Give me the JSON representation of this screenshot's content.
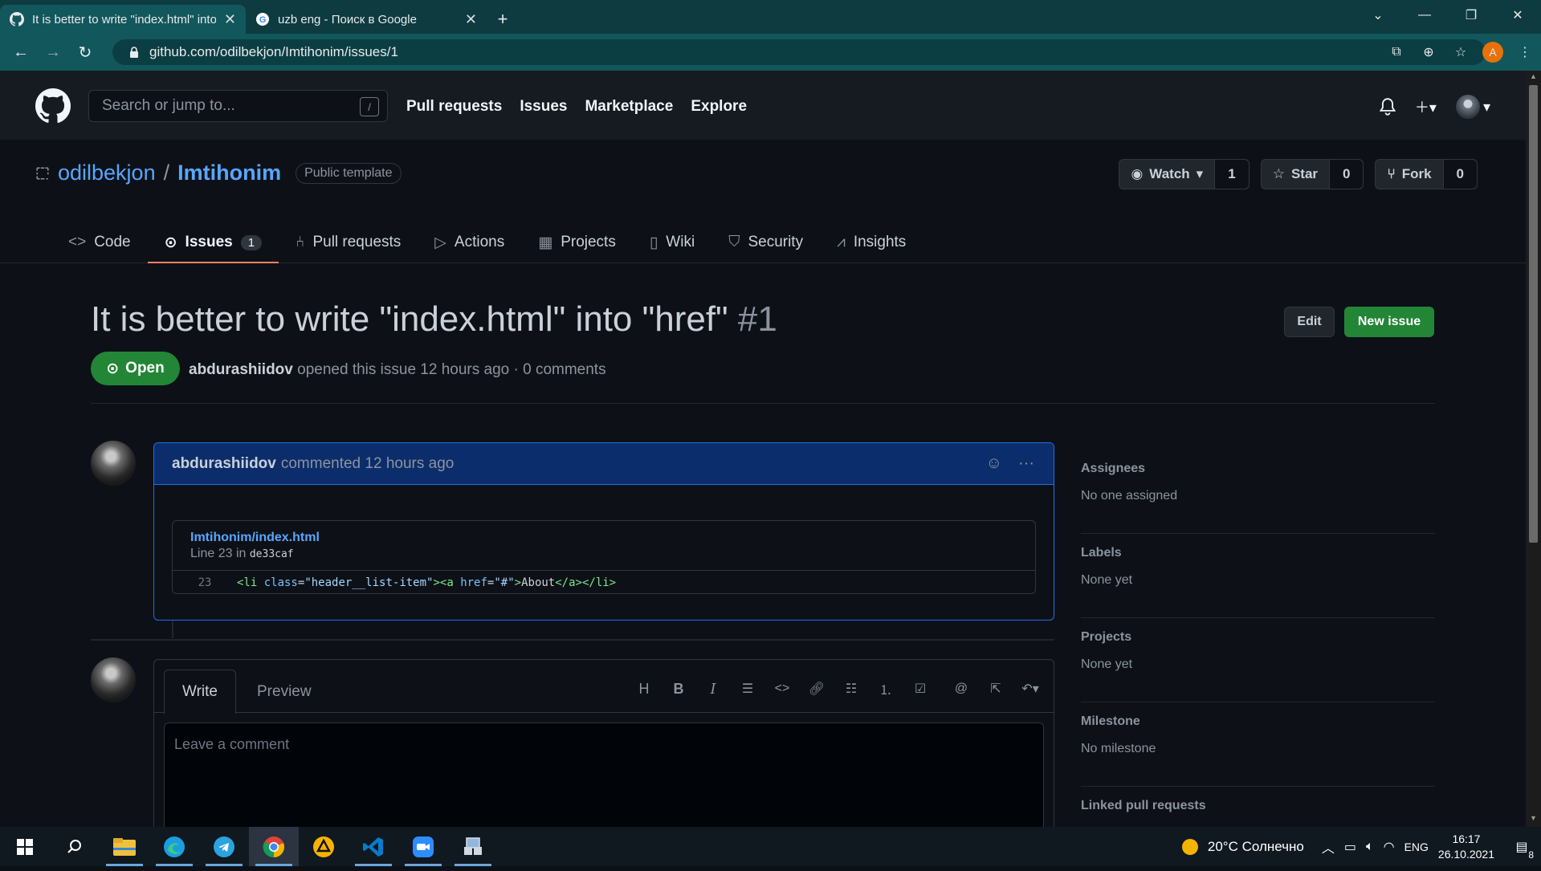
{
  "browser": {
    "tabs": [
      {
        "title": "It is better to write \"index.html\" into \"href\"",
        "active": true
      },
      {
        "title": "uzb eng - Поиск в Google",
        "active": false
      }
    ],
    "url": "github.com/odilbekjon/Imtihonim/issues/1",
    "profile_initial": "A"
  },
  "gh_header": {
    "search_placeholder": "Search or jump to...",
    "slash_key": "/",
    "nav": [
      "Pull requests",
      "Issues",
      "Marketplace",
      "Explore"
    ]
  },
  "repo": {
    "owner": "odilbekjon",
    "separator": "/",
    "name": "Imtihonim",
    "badge": "Public template",
    "watch": {
      "label": "Watch",
      "count": "1"
    },
    "star": {
      "label": "Star",
      "count": "0"
    },
    "fork": {
      "label": "Fork",
      "count": "0"
    },
    "tabs": [
      {
        "label": "Code",
        "icon": "code-icon"
      },
      {
        "label": "Issues",
        "icon": "issue-icon",
        "count": "1",
        "selected": true
      },
      {
        "label": "Pull requests",
        "icon": "pull-request-icon"
      },
      {
        "label": "Actions",
        "icon": "play-icon"
      },
      {
        "label": "Projects",
        "icon": "project-icon"
      },
      {
        "label": "Wiki",
        "icon": "book-icon"
      },
      {
        "label": "Security",
        "icon": "shield-icon"
      },
      {
        "label": "Insights",
        "icon": "graph-icon"
      }
    ]
  },
  "issue": {
    "title": "It is better to write \"index.html\" into \"href\"",
    "number": "#1",
    "state": "Open",
    "author": "abdurashiidov",
    "meta_rest": "opened this issue 12 hours ago · 0 comments",
    "edit_label": "Edit",
    "new_issue_label": "New issue"
  },
  "comment": {
    "author": "abdurashiidov",
    "action": "commented 12 hours ago",
    "snippet": {
      "file": "Imtihonim/index.html",
      "line_prefix": "Line 23 in",
      "commit": "de33caf",
      "line_number": "23",
      "code_parts": [
        {
          "t": "tag",
          "v": "<li "
        },
        {
          "t": "attr",
          "v": "class"
        },
        {
          "t": "txt",
          "v": "="
        },
        {
          "t": "str",
          "v": "\"header__list-item\""
        },
        {
          "t": "tag",
          "v": ">"
        },
        {
          "t": "tag",
          "v": "<a "
        },
        {
          "t": "attr",
          "v": "href"
        },
        {
          "t": "txt",
          "v": "="
        },
        {
          "t": "str",
          "v": "\"#\""
        },
        {
          "t": "tag",
          "v": ">"
        },
        {
          "t": "txt",
          "v": "About"
        },
        {
          "t": "tag",
          "v": "</a></li>"
        }
      ]
    }
  },
  "editor": {
    "write_tab": "Write",
    "preview_tab": "Preview",
    "placeholder": "Leave a comment"
  },
  "sidebar": [
    {
      "heading": "Assignees",
      "value": "No one assigned"
    },
    {
      "heading": "Labels",
      "value": "None yet"
    },
    {
      "heading": "Projects",
      "value": "None yet"
    },
    {
      "heading": "Milestone",
      "value": "No milestone"
    },
    {
      "heading": "Linked pull requests",
      "value": ""
    }
  ],
  "taskbar": {
    "weather": "20°C Солнечно",
    "lang": "ENG",
    "time": "16:17",
    "date": "26.10.2021",
    "notif_count": "8"
  },
  "colors": {
    "bg": "#0d1117",
    "header": "#161b22",
    "accent_link": "#58a6ff",
    "green": "#238636",
    "tab_underline": "#f78166",
    "browser_chrome": "#12575b"
  }
}
